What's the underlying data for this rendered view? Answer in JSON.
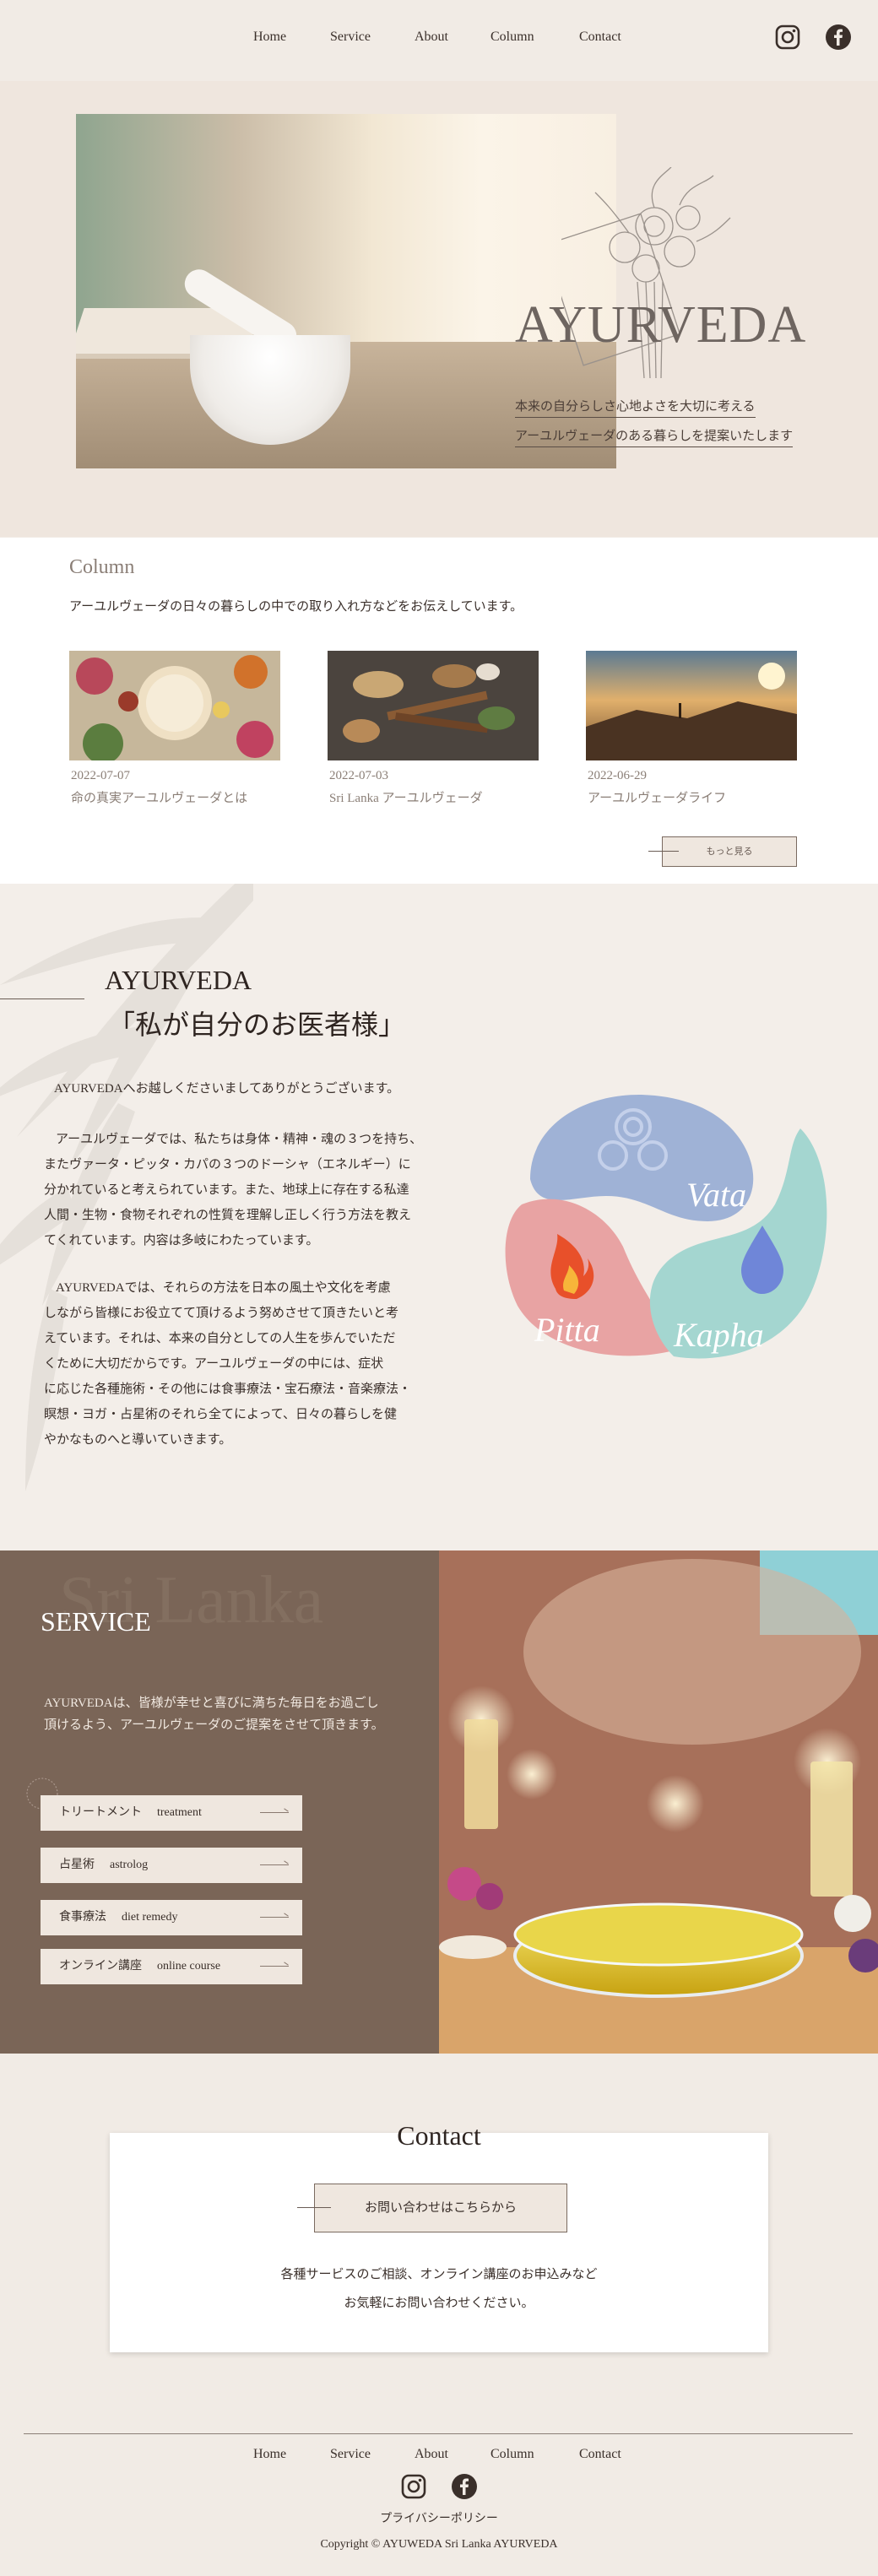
{
  "nav": {
    "links": [
      "Home",
      "Service",
      "About",
      "Column",
      "Contact"
    ],
    "icons": [
      "instagram-icon",
      "facebook-icon"
    ]
  },
  "hero": {
    "title": "AYURVEDA",
    "subtitle_1": "本来の自分らしさ心地よさを大切に考える",
    "subtitle_2": "アーユルヴェーダのある暮らしを提案いたします"
  },
  "column": {
    "title": "Column",
    "description": "アーユルヴェーダの日々の暮らしの中での取り入れ方などをお伝えしています。",
    "cards": [
      {
        "date": "2022-07-07",
        "title": "命の真実アーユルヴェーダとは"
      },
      {
        "date": "2022-07-03",
        "title": "Sri Lanka アーユルヴェーダ"
      },
      {
        "date": "2022-06-29",
        "title": "アーユルヴェーダライフ"
      }
    ],
    "more_label": "もっと見る"
  },
  "intro": {
    "heading_en": "AYURVEDA",
    "heading_jp": "「私が自分のお医者様」",
    "paragraphs": [
      [
        "AYURVEDAへお越しくださいましてありがとうございます。"
      ],
      [
        "アーユルヴェーダでは、私たちは身体・精神・魂の３つを持ち、",
        "またヴァータ・ピッタ・カパの３つのドーシャ（エネルギー）に",
        "分かれていると考えられています。また、地球上に存在する私達",
        "人間・生物・食物それぞれの性質を理解し正しく行う方法を教え",
        "てくれています。内容は多岐にわたっています。"
      ],
      [
        "AYURVEDAでは、それらの方法を日本の風土や文化を考慮",
        "しながら皆様にお役立てて頂けるよう努めさせて頂きたいと考",
        "えています。それは、本来の自分としての人生を歩んでいただ",
        "くために大切だからです。アーユルヴェーダの中には、症状",
        "に応じた各種施術・その他には食事療法・宝石療法・音楽療法・",
        "瞑想・ヨガ・占星術のそれら全てによって、日々の暮らしを健",
        "やかなものへと導いていきます。"
      ]
    ],
    "dosha": [
      "Vata",
      "Pitta",
      "Kapha"
    ],
    "dosha_colors": {
      "vata": "#9fb2d6",
      "pitta": "#e8a3a3",
      "kapha": "#a4d6d0"
    }
  },
  "service": {
    "watermark": "Sri Lanka",
    "title": "SERVICE",
    "description_1": "AYURVEDAは、皆様が幸せと喜びに満ちた毎日をお過ごし",
    "description_2": "頂けるよう、アーユルヴェーダのご提案をさせて頂きます。",
    "buttons": [
      {
        "jp": "トリートメント",
        "en": "treatment"
      },
      {
        "jp": "占星術",
        "en": "astrolog"
      },
      {
        "jp": "食事療法",
        "en": "diet remedy"
      },
      {
        "jp": "オンライン講座",
        "en": "online course"
      }
    ]
  },
  "contact": {
    "title": "Contact",
    "button": "お問い合わせはこちらから",
    "text_1": "各種サービスのご相談、オンライン講座のお申込みなど",
    "text_2": "お気軽にお問い合わせください。"
  },
  "footer": {
    "links": [
      "Home",
      "Service",
      "About",
      "Column",
      "Contact"
    ],
    "policy": "プライバシーポリシー",
    "copyright": "Copyright © AYUWEDA Sri Lanka AYURVEDA"
  }
}
